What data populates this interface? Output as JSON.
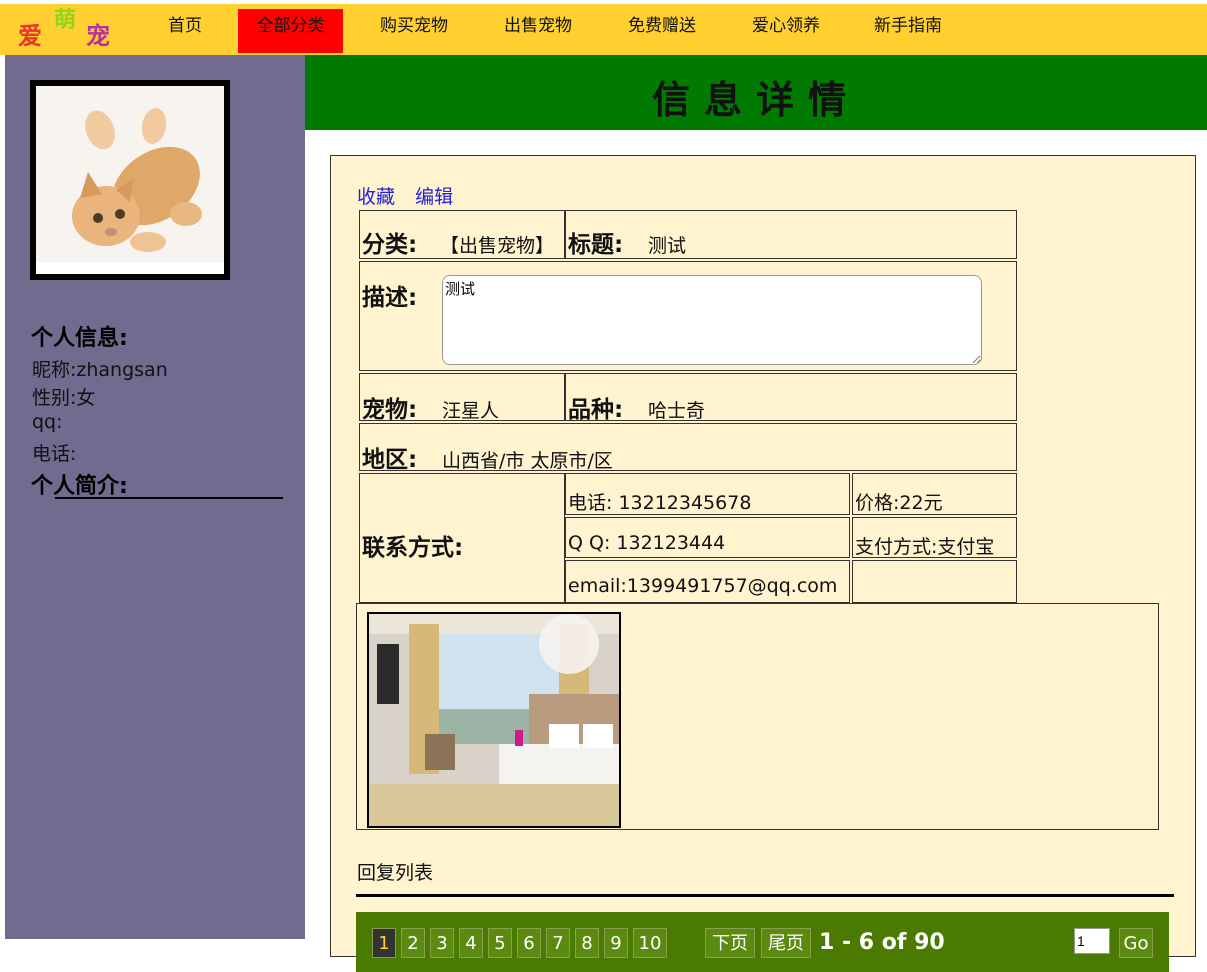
{
  "logo": {
    "c1": "爱",
    "c2": "萌",
    "c3": "宠"
  },
  "nav": [
    {
      "label": "首页"
    },
    {
      "label": "全部分类"
    },
    {
      "label": "购买宠物"
    },
    {
      "label": "出售宠物"
    },
    {
      "label": "免费赠送"
    },
    {
      "label": "爱心领养"
    },
    {
      "label": "新手指南"
    }
  ],
  "colors": {
    "nav_bg": "#ffd030",
    "nav_active": "#ff0000",
    "sidebar": "#736a8f",
    "header": "#007a00",
    "panel": "#fff3d0",
    "pager": "#4a7a00"
  },
  "sidebar": {
    "info_heading": "个人信息:",
    "nickname": "昵称:zhangsan",
    "gender": "性别:女",
    "qq": "qq:",
    "phone": "电话:",
    "intro_heading": "个人简介:"
  },
  "page_title": "信息详情",
  "links": {
    "favorite": "收藏",
    "edit": "编辑"
  },
  "detail": {
    "category_label": "分类:",
    "category_value": "【出售宠物】",
    "title_label": "标题:",
    "title_value": "测试",
    "desc_label": "描述:",
    "desc_value": "测试",
    "pet_label": "宠物:",
    "pet_value": "汪星人",
    "breed_label": "品种:",
    "breed_value": "哈士奇",
    "region_label": "地区:",
    "region_value": "山西省/市 太原市/区",
    "contact_label": "联系方式:",
    "phone": "电话: 13212345678",
    "qq": "Q Q: 132123444",
    "email": "email:1399491757@qq.com",
    "price": "价格:22元",
    "payment": "支付方式:支付宝"
  },
  "reply": {
    "label": "回复列表"
  },
  "pager": {
    "pages": [
      "1",
      "2",
      "3",
      "4",
      "5",
      "6",
      "7",
      "8",
      "9",
      "10"
    ],
    "next": "下页",
    "last": "尾页",
    "info": "1 - 6 of 90",
    "input_value": "1",
    "go": "Go"
  }
}
